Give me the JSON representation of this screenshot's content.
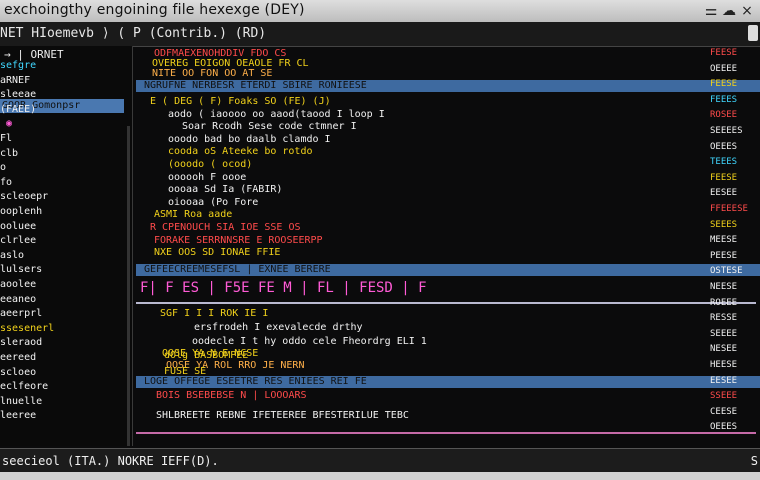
{
  "window": {
    "title": "exchoingthy engoining file hexexge (DEY)",
    "controls": [
      "⚌",
      "☁",
      "×"
    ]
  },
  "tabbar": {
    "tab": "NET HIoemevb ⟩ ( P (Contrib.) (RD)"
  },
  "sidebar": {
    "header": "→ | ORNET",
    "selected": "GOOR Gomonpsr",
    "items": [
      "sefgre",
      "aRNEF",
      "sleeae",
      "(FAEE)",
      "◉",
      "Fl",
      "clb",
      "o",
      "fo",
      "scleoepr",
      "ooplenh",
      "ooluee",
      "clrlee",
      "aslo",
      "lulsers",
      "aoolee",
      "eeaneo",
      "aeerprl",
      "ssesenerl",
      "sleraod",
      "eereed",
      "scloeo",
      "eclfeore",
      "lnuelle",
      "leeree"
    ]
  },
  "main": {
    "bands": [
      "NGRUFNE NERBESR ETERDI SBIRE RONIEESE",
      "GEFEECREEMESEFSL  | EXNEE BERERE",
      "LOGE OFFEGE ESEETRE RES  ENIEES REI  FE"
    ],
    "lines1": [
      "ODFMAEXENOHDDIV  FDO  CS",
      "OVEREG EOIGON  OEAOLE FR  CL",
      "NITE   OO FON  OO  AT   SE",
      "E ( DEG (  F) Foaks   SO  (FE) (J)",
      "aodo ( iaoooo  oo aaod(taood  I  loop  I",
      "Soar Rcodh  Sese  code ctmner  I",
      "ooodo  bad  bo  daalb  clamdo  I",
      "cooda  oS  Ateeke  bo  rotdo",
      "(ooodo (  ocod)",
      "oooooh  F  oooe",
      "oooaa  Sd  Ia (FABIR)",
      "oiooaa  (Po  Fore",
      "ASMI  Roa  aade",
      "R  CPENOUCH  SIA  IOE  SSE  OS",
      "FORAKE  SERRNNSRE  E  ROOSEERPP",
      "NXE  OOS  SD  IONAE  FFIE"
    ],
    "block2": "F| F ES | F5E FE M | FL | FESD  | F",
    "lines2": [
      "SGF  I  I  I  ROK  IE  I",
      "ersfrodeh   I  exevalecde  drthy",
      "oodecle  I  t  hy  oddo  cele  Fheordrg  ELI  1",
      "dOlg  BASBOMPEE"
    ],
    "lines3": [
      "OOSE  YA  N  E  NCSE",
      "OOSE  YA  ROL  RRO  JE  NERN",
      "FUSE  SE",
      "BOIS  BSEBEBSE  N  |  LOOOARS",
      "SHLBREETE  REBNE  IFETEEREE  BFESTERILUE  TEBC"
    ],
    "rail": [
      "FEESE",
      "OEEEE",
      "FEESE",
      "FEEES",
      "ROSEE",
      "SEEEES",
      "OEEES",
      "TEEES",
      "FEESE",
      "EESEE",
      "FFEEESE",
      "SEEES",
      "MEESE",
      "PEESE",
      "OSTESE",
      "NEESE",
      "ROEEE",
      "RESSE",
      "SEEEE",
      "NESEE",
      "HEESE",
      "EESEE",
      "SSEEE",
      "CEESE",
      "OEEES"
    ]
  },
  "status": {
    "text": "seecieol (ITA.)  NOKRE IEFF(D).",
    "end": "S"
  }
}
